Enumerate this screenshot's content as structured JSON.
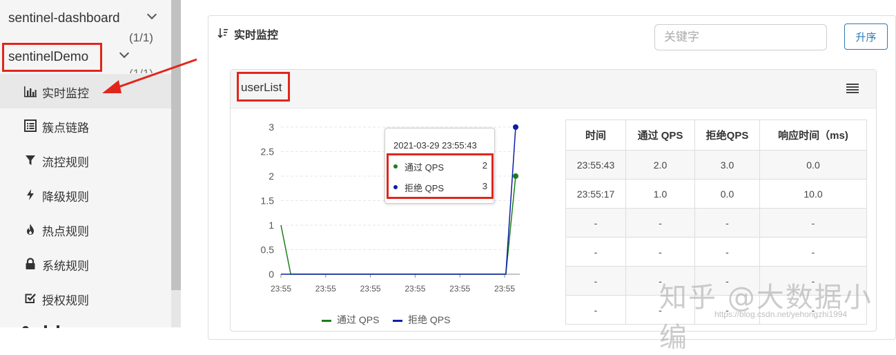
{
  "sidebar": {
    "apps": [
      {
        "name": "sentinel-dashboard",
        "count": "(1/1)"
      },
      {
        "name": "sentinelDemo",
        "count": "(1/1)"
      }
    ],
    "items": [
      {
        "label": "实时监控",
        "icon": "bar-chart-icon"
      },
      {
        "label": "簇点链路",
        "icon": "list-icon"
      },
      {
        "label": "流控规则",
        "icon": "filter-icon"
      },
      {
        "label": "降级规则",
        "icon": "bolt-icon"
      },
      {
        "label": "热点规则",
        "icon": "fire-icon"
      },
      {
        "label": "系统规则",
        "icon": "lock-icon"
      },
      {
        "label": "授权规则",
        "icon": "check-square-icon"
      }
    ]
  },
  "panel": {
    "title": "实时监控",
    "search_placeholder": "关键字",
    "sort_label": "升序"
  },
  "card": {
    "title": "userList"
  },
  "chart_data": {
    "type": "line",
    "x": [
      "23:55",
      "23:55",
      "23:55",
      "23:55",
      "23:55",
      "23:55"
    ],
    "yticks": [
      "0",
      "0.5",
      "1",
      "1.5",
      "2",
      "2.5",
      "3"
    ],
    "ylim": [
      0,
      3
    ],
    "series": [
      {
        "name": "通过 QPS",
        "color": "#1a7f1a",
        "values": [
          1,
          0,
          0,
          0,
          0,
          0,
          0,
          0,
          0,
          0,
          0,
          0,
          0,
          0,
          0,
          0,
          0,
          0,
          0,
          0,
          0,
          0,
          0,
          0,
          2
        ]
      },
      {
        "name": "拒绝 QPS",
        "color": "#0a1ea8",
        "values": [
          0,
          0,
          0,
          0,
          0,
          0,
          0,
          0,
          0,
          0,
          0,
          0,
          0,
          0,
          0,
          0,
          0,
          0,
          0,
          0,
          0,
          0,
          0,
          0,
          3
        ]
      }
    ],
    "legend": "bottom"
  },
  "tooltip": {
    "time": "2021-03-29 23:55:43",
    "rows": [
      {
        "name": "通过 QPS",
        "value": "2",
        "color": "#1a7f1a"
      },
      {
        "name": "拒绝 QPS",
        "value": "3",
        "color": "#0a1ea8"
      }
    ]
  },
  "table": {
    "headers": [
      "时间",
      "通过 QPS",
      "拒绝QPS",
      "响应时间（ms)"
    ],
    "rows": [
      [
        "23:55:43",
        "2.0",
        "3.0",
        "0.0"
      ],
      [
        "23:55:17",
        "1.0",
        "0.0",
        "10.0"
      ],
      [
        "-",
        "-",
        "-",
        "-"
      ],
      [
        "-",
        "-",
        "-",
        "-"
      ],
      [
        "-",
        "-",
        "-",
        "-"
      ],
      [
        "-",
        "-",
        "-",
        "-"
      ]
    ]
  },
  "watermark": "知乎 @大数据小编",
  "watermark_url": "https://blog.csdn.net/yehongzhi1994"
}
